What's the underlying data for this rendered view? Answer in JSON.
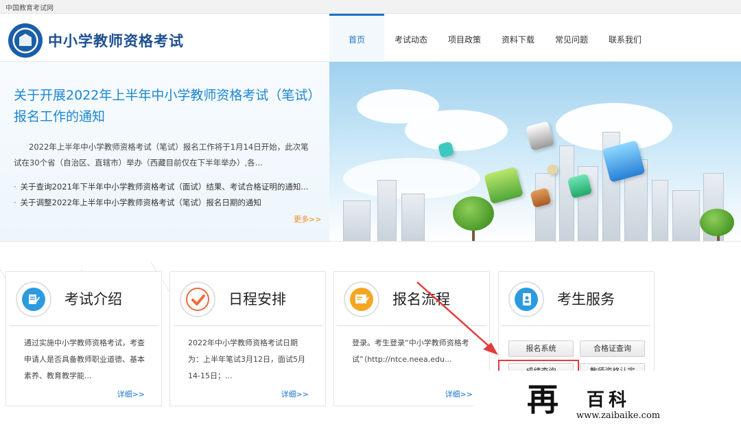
{
  "topbar": {
    "text": "中国教育考试网"
  },
  "header": {
    "site_name": "中小学教师资格考试",
    "nav": [
      "首页",
      "考试动态",
      "项目政策",
      "资料下载",
      "常见问题",
      "联系我们"
    ]
  },
  "hero": {
    "title": "关于开展2022年上半年中小学教师资格考试（笔试）报名工作的通知",
    "summary": "2022年上半年中小学教师资格考试（笔试）报名工作将于1月14日开始，此次笔试在30个省（自治区、直辖市）举办（西藏目前仅在下半年举办）,各...",
    "links": [
      "关于查询2021年下半年中小学教师资格考试（面试）结果、考试合格证明的通知...",
      "关于调整2022年上半年中小学教师资格考试（笔试）报名日期的通知"
    ],
    "bullet": "·",
    "more": "更多>>"
  },
  "cards": [
    {
      "title": "考试介绍",
      "desc": "通过实施中小学教师资格考试，考查申请人是否具备教师职业道德、基本素养、教育教学能...",
      "detail": "详细>>"
    },
    {
      "title": "日程安排",
      "desc": "2022年中小学教师资格考试日期为：上半年笔试3月12日，面试5月14-15日；...",
      "detail": "详细>>"
    },
    {
      "title": "报名流程",
      "desc": "登录。考生登录“中小学教师资格考试”（http://ntce.neea.edu...",
      "detail": "详细>>"
    },
    {
      "title": "考生服务",
      "buttons": [
        "报名系统",
        "合格证查询",
        "成绩查询",
        "教师资格认定"
      ]
    }
  ],
  "watermark": {
    "char1": "再",
    "char2": "百科",
    "url": "www.zaibaike.com"
  },
  "colors": {
    "primary": "#1a73c9",
    "title_blue": "#1b86d1",
    "accent_orange": "#f08a24",
    "annotation_red": "#e23c3c"
  }
}
